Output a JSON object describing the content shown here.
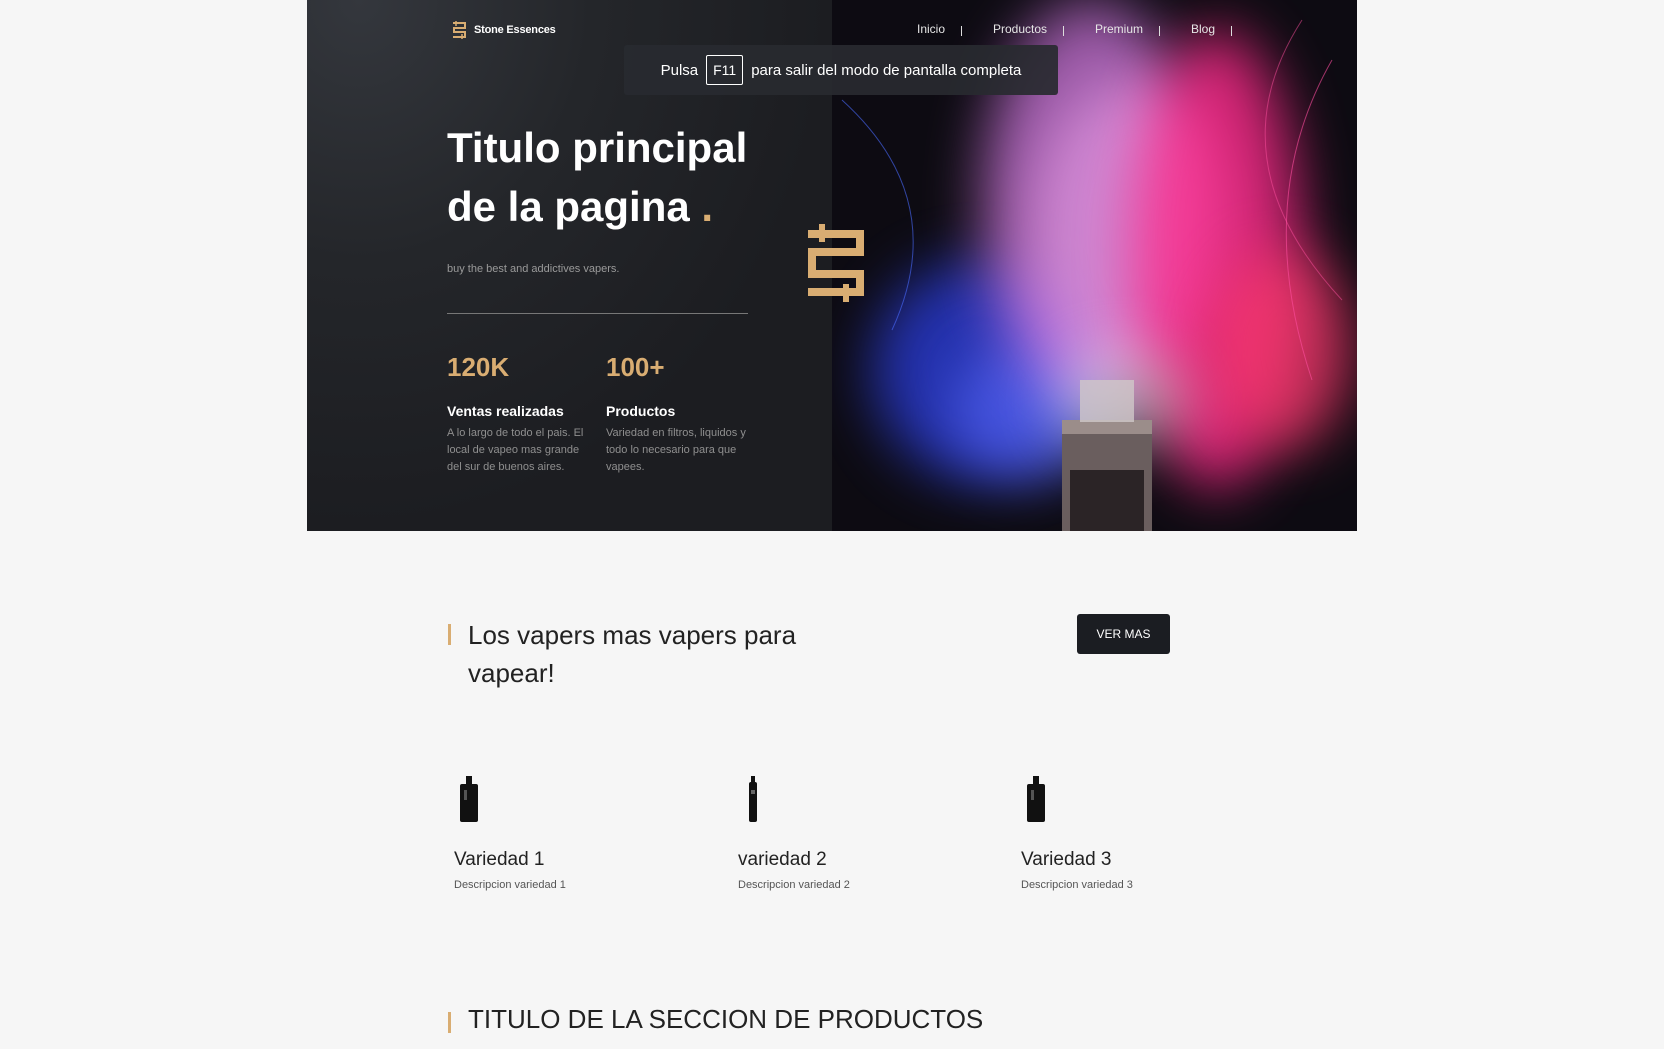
{
  "brand": {
    "name": "Stone Essences"
  },
  "nav": {
    "items": [
      "Inicio",
      "Productos",
      "Premium",
      "Blog"
    ]
  },
  "fullscreen_toast": {
    "before": "Pulsa",
    "key": "F11",
    "after": "para salir del modo de pantalla completa"
  },
  "hero": {
    "title_line1": "Titulo principal",
    "title_line2": "de la pagina",
    "title_dot": ".",
    "subtitle": "buy the best and addictives vapers.",
    "stats": [
      {
        "value": "120K",
        "label": "Ventas realizadas",
        "desc": "A lo largo de todo el pais. El local de vapeo mas grande del sur de buenos aires."
      },
      {
        "value": "100+",
        "label": "Productos",
        "desc": "Variedad en filtros, liquidos y todo lo necesario para que vapees."
      }
    ]
  },
  "section1": {
    "title": "Los vapers mas vapers para vapear!",
    "button": "VER MAS",
    "cards": [
      {
        "title": "Variedad 1",
        "desc": "Descripcion variedad 1",
        "icon": "vape-box-icon"
      },
      {
        "title": "variedad 2",
        "desc": "Descripcion variedad 2",
        "icon": "vape-pen-icon"
      },
      {
        "title": "Variedad 3",
        "desc": "Descripcion variedad 3",
        "icon": "vape-box-icon"
      }
    ]
  },
  "section2": {
    "title": "TITULO DE LA SECCION DE PRODUCTOS"
  },
  "colors": {
    "accent": "#d9ad72",
    "dark": "#1c1d21",
    "background": "#f6f6f6"
  }
}
